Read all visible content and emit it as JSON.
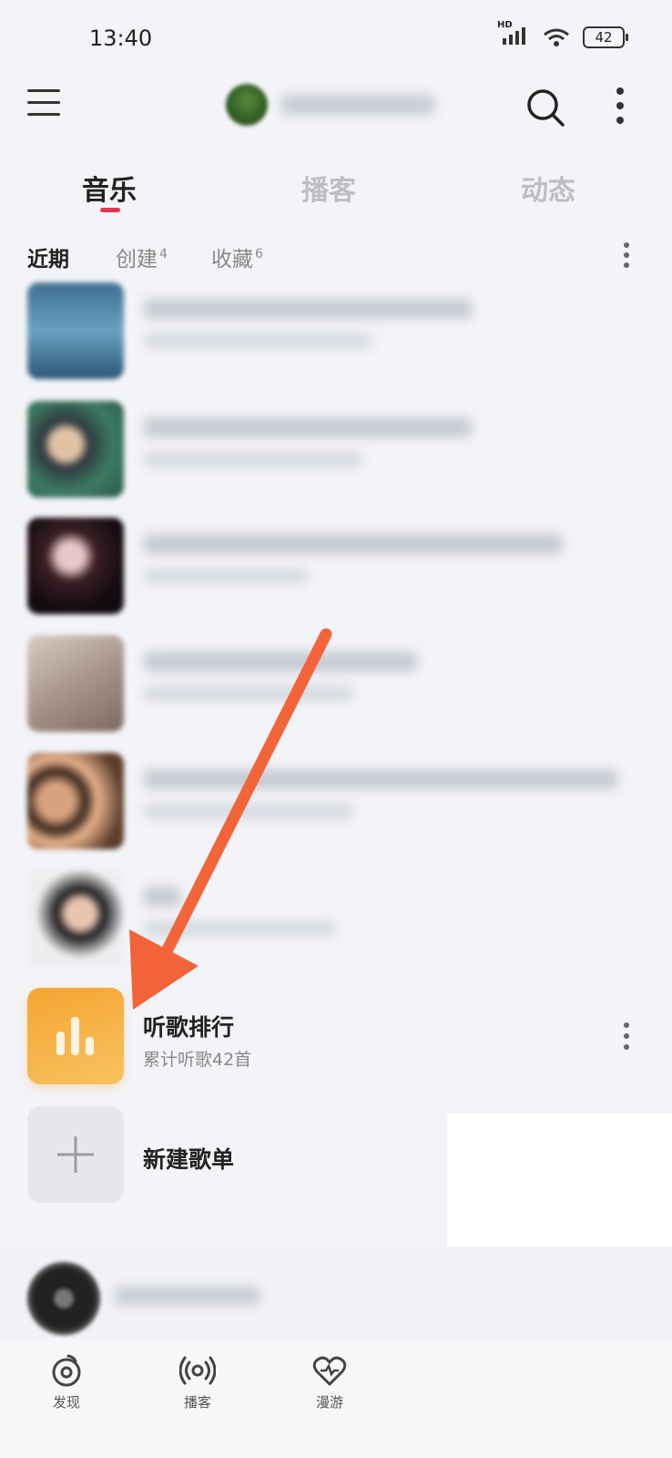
{
  "status": {
    "time": "13:40",
    "battery": "42",
    "signal_badge": "HD"
  },
  "header": {
    "menu_icon": "menu-icon",
    "search_icon": "search-icon",
    "more_icon": "more-vertical-icon"
  },
  "tabs": [
    {
      "label": "音乐",
      "active": true
    },
    {
      "label": "播客",
      "active": false
    },
    {
      "label": "动态",
      "active": false
    }
  ],
  "subtabs": [
    {
      "label": "近期",
      "count": ""
    },
    {
      "label": "创建",
      "count": "4"
    },
    {
      "label": "收藏",
      "count": "6"
    }
  ],
  "ranking": {
    "title": "听歌排行",
    "subtitle": "累计听歌42首"
  },
  "new_playlist": {
    "title": "新建歌单"
  },
  "bottom_nav": [
    {
      "label": "发现",
      "icon": "netease-discover-icon"
    },
    {
      "label": "播客",
      "icon": "podcast-icon"
    },
    {
      "label": "漫游",
      "icon": "roaming-heart-icon"
    }
  ],
  "colors": {
    "accent": "#e8344a",
    "ranking_orange": "#f5a531",
    "annotation_arrow": "#f4643a"
  }
}
